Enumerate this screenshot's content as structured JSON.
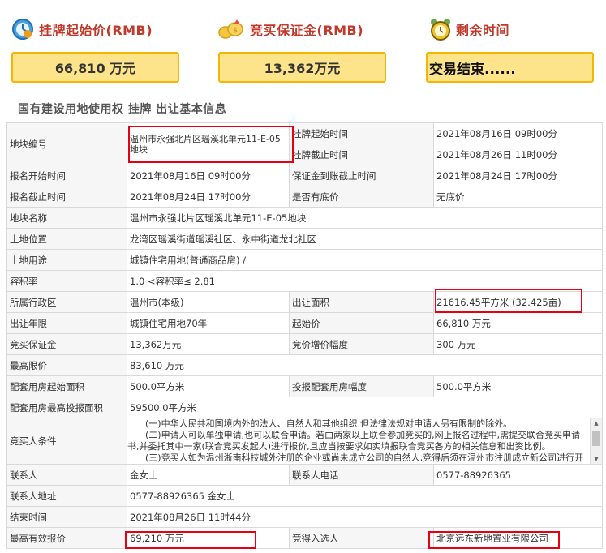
{
  "header": {
    "start_price_label": "挂牌起始价(RMB)",
    "deposit_label": "竞买保证金(RMB)",
    "time_label": "剩余时间",
    "start_price_value": "66,810 万元",
    "deposit_value": "13,362万元",
    "time_value": "交易结束......",
    "icons": [
      "clock-icon",
      "coins-icon",
      "alarm-clock-icon"
    ]
  },
  "section_title": "国有建设用地使用权 挂牌 出让基本信息",
  "rows": {
    "parcel_no_label": "地块编号",
    "parcel_no_value": "温州市永强北片区瑶溪北单元11-E-05地块",
    "listing_start_label": "挂牌起始时间",
    "listing_start_value": "2021年08月16日 09时00分",
    "listing_end_label": "挂牌截止时间",
    "listing_end_value": "2021年08月26日 11时00分",
    "reg_start_label": "报名开始时间",
    "reg_start_value": "2021年08月16日 09时00分",
    "deposit_deadline_label": "保证金到账截止时间",
    "deposit_deadline_value": "2021年08月24日 17时00分",
    "reg_end_label": "报名截止时间",
    "reg_end_value": "2021年08月24日 17时00分",
    "reserve_label": "是否有底价",
    "reserve_value": "无底价",
    "name_label": "地块名称",
    "name_value": "温州市永强北片区瑶溪北单元11-E-05地块",
    "location_label": "土地位置",
    "location_value": "龙湾区瑶溪街道瑶溪社区、永中街道龙北社区",
    "use_label": "土地用途",
    "use_value": "城镇住宅用地(普通商品房) /",
    "far_label": "容积率",
    "far_value": "1.0 <容积率≤ 2.81",
    "district_label": "所属行政区",
    "district_value": "温州市(本级)",
    "area_label": "出让面积",
    "area_value": "21616.45平方米 (32.425亩)",
    "term_label": "出让年限",
    "term_value": "城镇住宅用地70年",
    "start_price_label": "起始价",
    "start_price_value": "66,810 万元",
    "bid_deposit_label": "竞买保证金",
    "bid_deposit_value": "13,362万元",
    "increment_label": "竞价增价幅度",
    "increment_value": "300 万元",
    "cap_label": "最高限价",
    "cap_value": "83,610 万元",
    "housing_start_label": "配套用房起始面积",
    "housing_start_value": "500.0平方米",
    "housing_inc_label": "投报配套用房幅度",
    "housing_inc_value": "500.0平方米",
    "housing_max_label": "配套用房最高投报面积",
    "housing_max_value": "59500.0平方米",
    "conditions_label": "竞买人条件",
    "conditions_p1": "(一)中华人民共和国境内外的法人、自然人和其他组织,但法律法规对申请人另有限制的除外。",
    "conditions_p2": "(二)申请人可以单独申请,也可以联合申请。若由两家以上联合参加竞买的,网上报名过程中,需提交联合竞买申请书,并委托其中一家(联合竞买发起人)进行报价,且应当按要求如实填报联合竞买各方的相关信息和出资比例。",
    "conditions_p3": "(三)竞买人如为温州浙南科技城外注册的企业或尚未成立公司的自然人,竞得后须在温州市注册成立新公司进行开发建设。",
    "contact_label": "联系人",
    "contact_value": "金女士",
    "phone_label": "联系人电话",
    "phone_value": "0577-88926365",
    "address_label": "联系人地址",
    "address_value": "0577-88926365 金女士",
    "end_time_label": "结束时间",
    "end_time_value": "2021年08月26日 11时44分",
    "top_bid_label": "最高有效报价",
    "top_bid_value": "69,210 万元",
    "winner_label": "竞得入选人",
    "winner_value": "北京远东新地置业有限公司"
  }
}
